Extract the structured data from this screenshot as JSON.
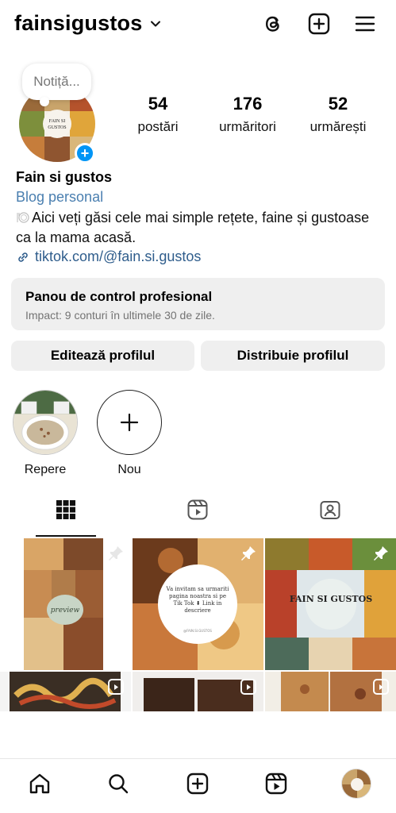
{
  "header": {
    "username": "fainsigustos",
    "icons": [
      "chevron-down-icon",
      "threads-icon",
      "add-post-icon",
      "menu-icon"
    ]
  },
  "note": {
    "placeholder": "Notiță..."
  },
  "stats": [
    {
      "value": "54",
      "label": "postări"
    },
    {
      "value": "176",
      "label": "urmăritori"
    },
    {
      "value": "52",
      "label": "urmărești"
    }
  ],
  "bio": {
    "name": "Fain si gustos",
    "category": "Blog personal",
    "text": "Aici veți găsi cele mai simple rețete, faine și gustoase ca la mama acasă.",
    "link": "tiktok.com/@fain.si.gustos"
  },
  "pro_dashboard": {
    "title": "Panou de control profesional",
    "subtitle": "Impact: 9 conturi în ultimele 30 de zile."
  },
  "buttons": {
    "edit": "Editează profilul",
    "share": "Distribuie profilul"
  },
  "highlights": [
    {
      "label": "Repere"
    },
    {
      "label": "Nou"
    }
  ],
  "tabs": [
    "grid-tab",
    "reels-tab",
    "tagged-tab"
  ],
  "grid": {
    "posts": [
      {
        "kind": "pinned",
        "overlay_text": "preview"
      },
      {
        "kind": "pinned",
        "overlay_text": "Va invitam sa urmariti pagina noastra si pe Tik Tok ⬇ Link in descriere",
        "small_text": "@FAIN.SI.GUSTOS"
      },
      {
        "kind": "pinned",
        "overlay_text": "FAIN SI GUSTOS"
      },
      {
        "kind": "reel"
      },
      {
        "kind": "reel"
      },
      {
        "kind": "reel"
      }
    ]
  },
  "colors": {
    "accent": "#0095f6",
    "link": "#2f5d8c",
    "category": "#4a7fb0",
    "panel": "#efefef",
    "muted": "#737373"
  },
  "bottom_nav": [
    "home-icon",
    "search-icon",
    "create-icon",
    "reels-icon",
    "profile-avatar"
  ]
}
